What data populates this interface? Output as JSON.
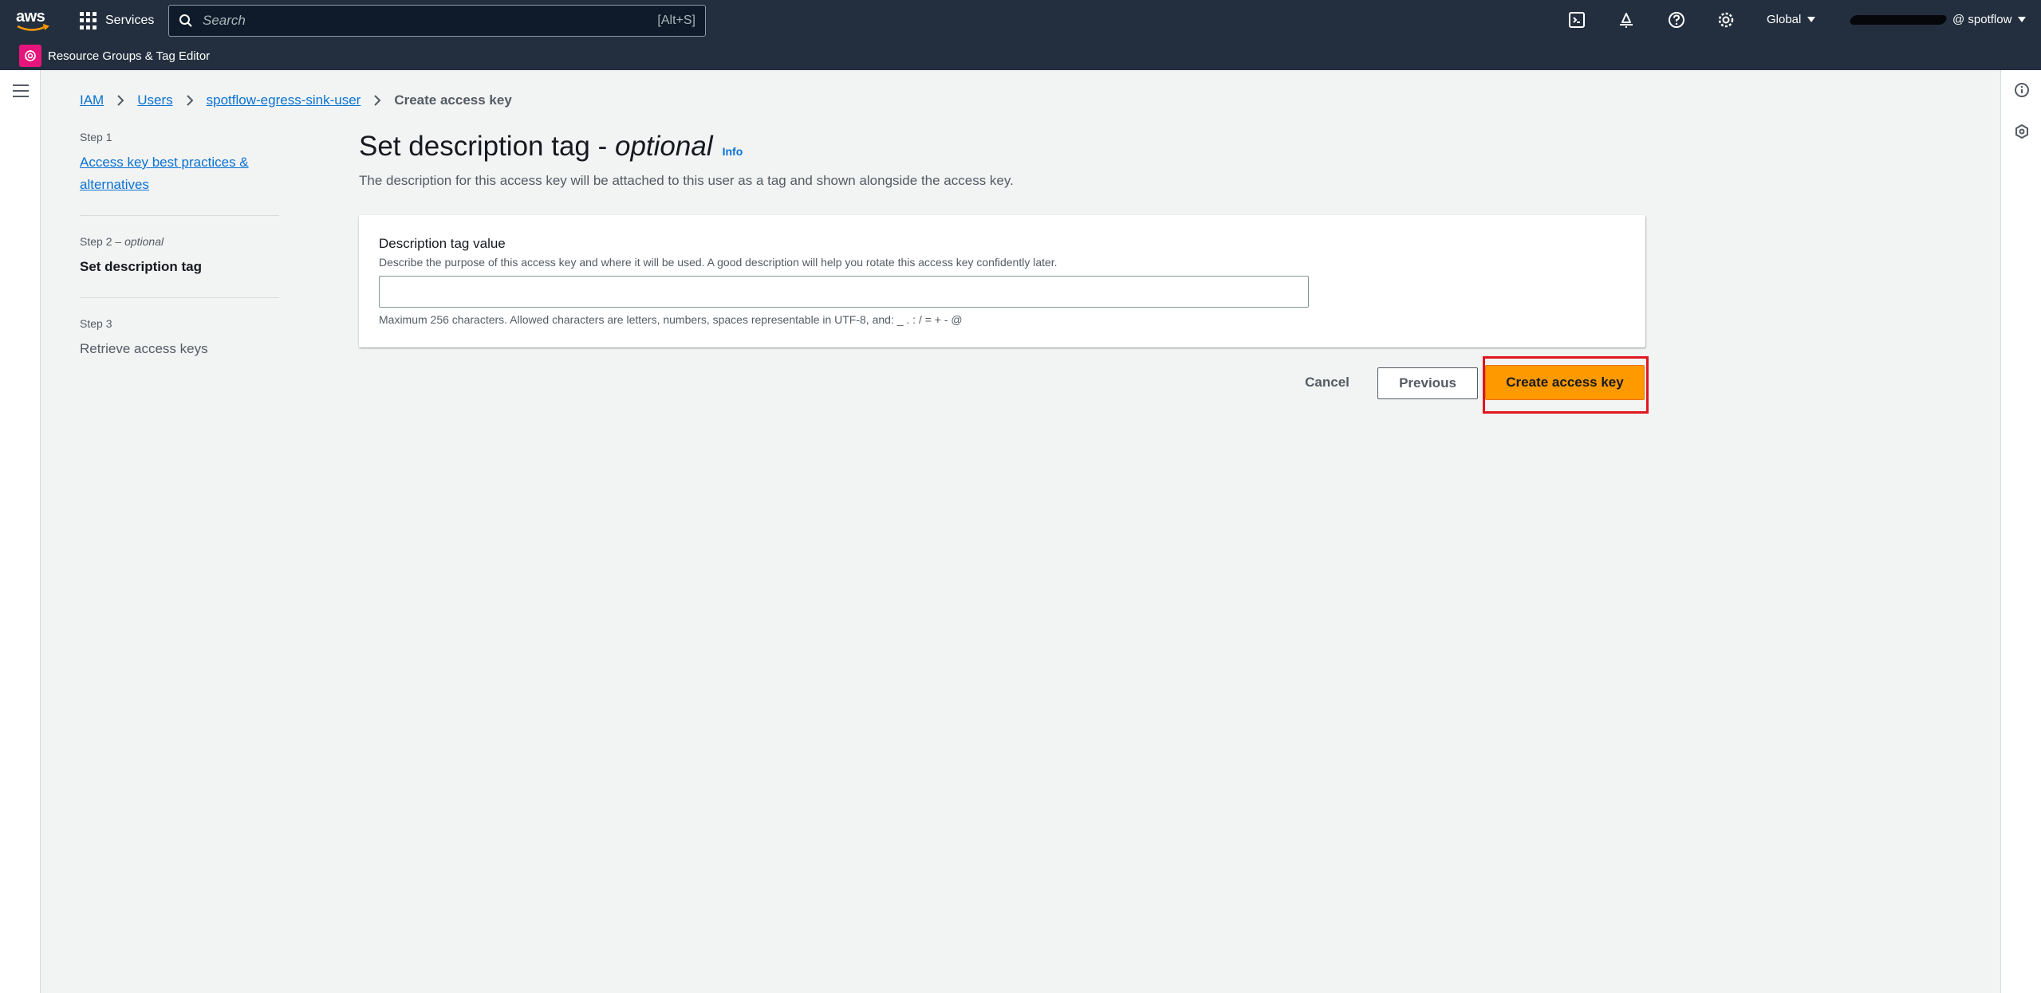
{
  "topnav": {
    "services_label": "Services",
    "search_placeholder": "Search",
    "search_shortcut": "[Alt+S]",
    "region_label": "Global",
    "account_label": "@ spotflow",
    "subbar_label": "Resource Groups & Tag Editor",
    "brand_color": "#232f3e",
    "icons": [
      "cloudshell-icon",
      "notifications-icon",
      "help-icon",
      "settings-icon"
    ]
  },
  "breadcrumb": {
    "items": [
      "IAM",
      "Users",
      "spotflow-egress-sink-user"
    ],
    "current": "Create access key"
  },
  "steps": [
    {
      "num": "Step 1",
      "title": "Access key best practices & alternatives"
    },
    {
      "num": "Step 2",
      "num_suffix": "optional",
      "title": "Set description tag"
    },
    {
      "num": "Step 3",
      "title": "Retrieve access keys"
    }
  ],
  "main": {
    "heading": "Set description tag - ",
    "heading_optional": "optional",
    "info_link": "Info",
    "description": "The description for this access key will be attached to this user as a tag and shown alongside the access key.",
    "field": {
      "label": "Description tag value",
      "description": "Describe the purpose of this access key and where it will be used. A good description will help you rotate this access key confidently later.",
      "value": "",
      "constraint": "Maximum 256 characters. Allowed characters are letters, numbers, spaces representable in UTF-8, and: _ . : / = + - @"
    }
  },
  "actions": {
    "cancel": "Cancel",
    "previous": "Previous",
    "create": "Create access key",
    "primary_color": "#ff9900",
    "highlight_color": "#e0161e"
  }
}
